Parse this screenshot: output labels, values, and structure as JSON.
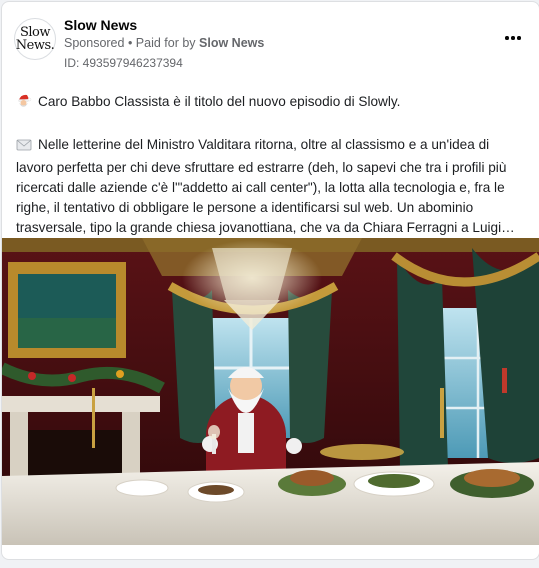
{
  "post": {
    "page_name": "Slow News",
    "avatar_text": [
      "Slow",
      "News."
    ],
    "sponsored_label": "Sponsored",
    "separator": " • ",
    "paid_for_by_prefix": "Paid for by ",
    "paid_for_by_name": "Slow News",
    "ad_id": "ID: 493597946237394",
    "more_icon": "more-horizontal-icon"
  },
  "body": {
    "line1_icon": "santa-emoji",
    "line1": "Caro Babbo Classista è il titolo del nuovo episodio di Slowly.",
    "para2_icon": "envelope-emoji",
    "para2": "Nelle letterine del Ministro Valditara ritorna, oltre al classismo e a un'idea di lavoro perfetta per chi deve sfruttare ed estrarre (deh, lo sapevi che tra i profili più ricercati dalle aziende c'è l'\"addetto ai call center\"), la lotta alla tecnologia e, fra le righe, il tentativo di obbligare le persone a identificarsi sul web. Un abominio trasversale, tipo la grande chiesa jovanottiana, che va da Chiara Ferragni a Luigi…"
  },
  "media": {
    "image_icon": "santa-banquet-image"
  },
  "colors": {
    "background": "#f0f2f5",
    "card": "#ffffff",
    "secondary_text": "#65676b"
  }
}
